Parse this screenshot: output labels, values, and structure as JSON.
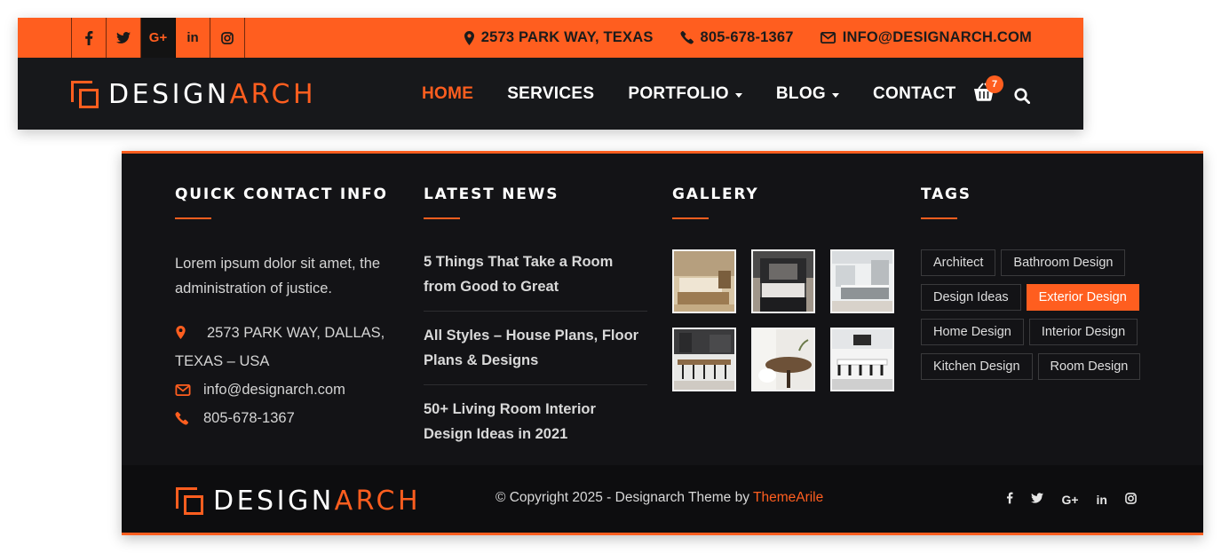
{
  "colors": {
    "accent": "#ff5e1f",
    "dark": "#17181b",
    "footer": "#131316"
  },
  "topbar": {
    "socials": [
      {
        "name": "facebook-icon",
        "glyph": "f"
      },
      {
        "name": "twitter-icon",
        "glyph": "t"
      },
      {
        "name": "google-plus-icon",
        "glyph": "G+"
      },
      {
        "name": "linkedin-icon",
        "glyph": "in"
      },
      {
        "name": "instagram-icon",
        "glyph": "ig"
      }
    ],
    "address": "2573 PARK WAY, TEXAS",
    "phone": "805-678-1367",
    "email": "INFO@DESIGNARCH.COM"
  },
  "brand": {
    "part1": "DESIGN",
    "part2": "ARCH"
  },
  "nav": {
    "items": [
      {
        "label": "HOME",
        "active": true,
        "dropdown": false
      },
      {
        "label": "SERVICES",
        "active": false,
        "dropdown": false
      },
      {
        "label": "PORTFOLIO",
        "active": false,
        "dropdown": true
      },
      {
        "label": "BLOG",
        "active": false,
        "dropdown": true
      },
      {
        "label": "CONTACT",
        "active": false,
        "dropdown": false
      }
    ],
    "cart_count": "7"
  },
  "footer": {
    "quick_contact": {
      "title": "QUICK CONTACT INFO",
      "text": "Lorem ipsum dolor sit amet, the administration of justice.",
      "address": "2573 PARK WAY, DALLAS, TEXAS – USA",
      "email": "info@designarch.com",
      "phone": "805-678-1367"
    },
    "latest_news": {
      "title": "LATEST NEWS",
      "items": [
        "5 Things That Take a Room from Good to Great",
        "All Styles – House Plans, Floor Plans & Designs",
        "50+ Living Room Interior Design Ideas in 2021"
      ]
    },
    "gallery": {
      "title": "GALLERY",
      "images": [
        "bedroom-photo",
        "dark-bedroom-photo",
        "kitchen-photo",
        "dining-photo",
        "wood-table-photo",
        "office-photo"
      ]
    },
    "tags": {
      "title": "TAGS",
      "items": [
        {
          "label": "Architect",
          "active": false
        },
        {
          "label": "Bathroom Design",
          "active": false
        },
        {
          "label": "Design Ideas",
          "active": false
        },
        {
          "label": "Exterior Design",
          "active": true
        },
        {
          "label": "Home Design",
          "active": false
        },
        {
          "label": "Interior Design",
          "active": false
        },
        {
          "label": "Kitchen Design",
          "active": false
        },
        {
          "label": "Room Design",
          "active": false
        }
      ]
    },
    "copyright_prefix": "© Copyright 2025 - Designarch Theme by ",
    "copyright_link": "ThemeArile",
    "socials": [
      {
        "name": "facebook-icon",
        "glyph": "f"
      },
      {
        "name": "twitter-icon",
        "glyph": "t"
      },
      {
        "name": "google-plus-icon",
        "glyph": "G+"
      },
      {
        "name": "linkedin-icon",
        "glyph": "in"
      },
      {
        "name": "instagram-icon",
        "glyph": "ig"
      }
    ]
  }
}
